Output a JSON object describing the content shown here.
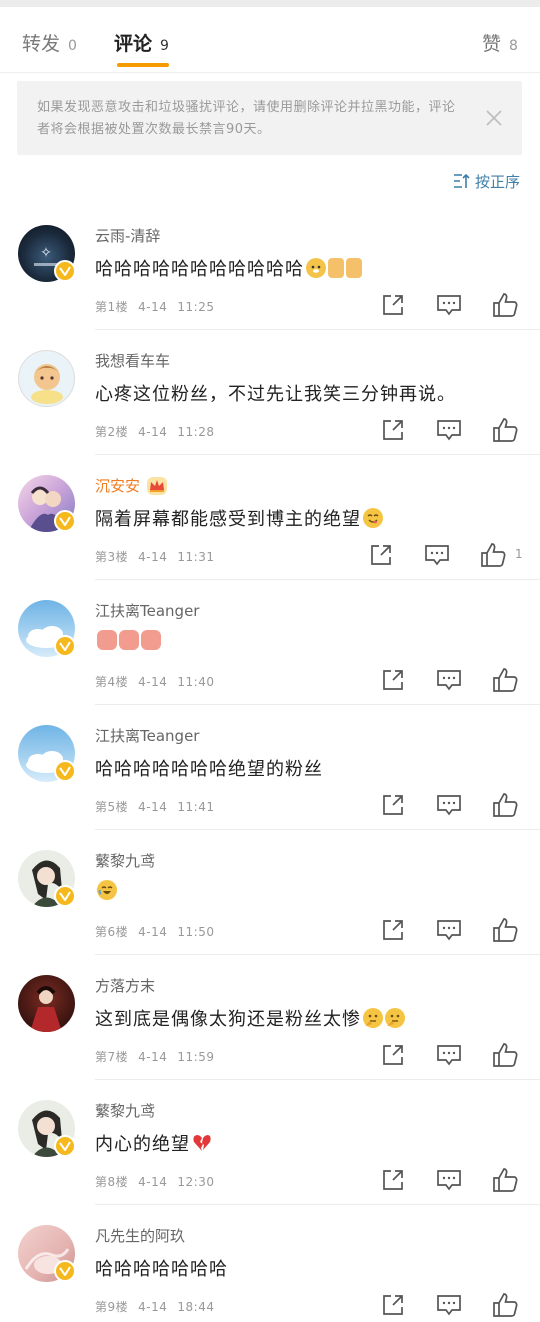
{
  "tabs": {
    "repost": {
      "label": "转发",
      "count": "0"
    },
    "comment": {
      "label": "评论",
      "count": "9"
    },
    "like": {
      "label": "赞",
      "count": "8"
    }
  },
  "notice": {
    "text": "如果发现恶意攻击和垃圾骚扰评论，请使用删除评论并拉黑功能，评论者将会根据被处置次数最长禁言90天。"
  },
  "sort": {
    "label": "按正序"
  },
  "colors": {
    "accent": "#f59b00",
    "link": "#3f7fa8",
    "vip_name": "#f07c22",
    "badge": "#f5b91e"
  },
  "comments": [
    {
      "user": "云雨-清辞",
      "text": "哈哈哈哈哈哈哈哈哈哈哈",
      "floor": "第1楼",
      "date": "4-14",
      "time": "11:25",
      "verified": true,
      "likes": ""
    },
    {
      "user": "我想看车车",
      "text": "心疼这位粉丝，不过先让我笑三分钟再说。",
      "floor": "第2楼",
      "date": "4-14",
      "time": "11:28",
      "verified": false,
      "likes": ""
    },
    {
      "user": "沉安安",
      "text": "隔着屏幕都能感受到博主的绝望",
      "floor": "第3楼",
      "date": "4-14",
      "time": "11:31",
      "verified": true,
      "likes": "1"
    },
    {
      "user": "江扶离Teanger",
      "text": "",
      "floor": "第4楼",
      "date": "4-14",
      "time": "11:40",
      "verified": true,
      "likes": ""
    },
    {
      "user": "江扶离Teanger",
      "text": "哈哈哈哈哈哈哈绝望的粉丝",
      "floor": "第5楼",
      "date": "4-14",
      "time": "11:41",
      "verified": true,
      "likes": ""
    },
    {
      "user": "蘩黎九鸢",
      "text": "",
      "floor": "第6楼",
      "date": "4-14",
      "time": "11:50",
      "verified": true,
      "likes": ""
    },
    {
      "user": "方落方末",
      "text": "这到底是偶像太狗还是粉丝太惨",
      "floor": "第7楼",
      "date": "4-14",
      "time": "11:59",
      "verified": false,
      "likes": ""
    },
    {
      "user": "蘩黎九鸢",
      "text": "内心的绝望",
      "floor": "第8楼",
      "date": "4-14",
      "time": "12:30",
      "verified": true,
      "likes": ""
    },
    {
      "user": "凡先生的阿玖",
      "text": "哈哈哈哈哈哈哈",
      "floor": "第9楼",
      "date": "4-14",
      "time": "18:44",
      "verified": true,
      "likes": ""
    }
  ]
}
